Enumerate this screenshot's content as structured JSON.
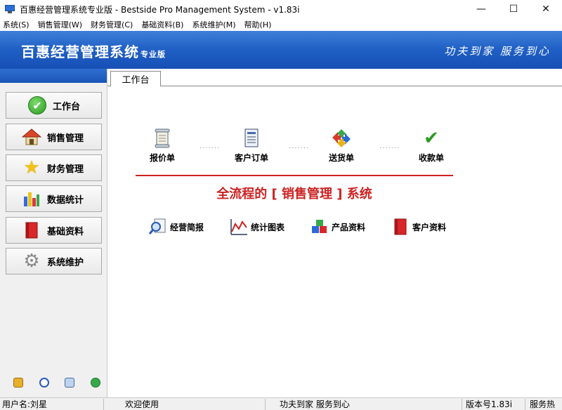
{
  "window": {
    "title": "百惠经营管理系统专业版 - Bestside Pro Management System - v1.83i",
    "minimize": "—",
    "maximize": "☐",
    "close": "✕"
  },
  "menu": [
    "系统(S)",
    "销售管理(W)",
    "财务管理(C)",
    "基础资料(B)",
    "系统维护(M)",
    "帮助(H)"
  ],
  "banner": {
    "title": "百惠经营管理系统",
    "subtitle": "专业版",
    "slogan": "功夫到家 服务到心"
  },
  "sidebar": {
    "items": [
      {
        "label": "工作台",
        "icon": "check-icon"
      },
      {
        "label": "销售管理",
        "icon": "house-icon"
      },
      {
        "label": "财务管理",
        "icon": "star-icon"
      },
      {
        "label": "数据统计",
        "icon": "bar-chart-icon"
      },
      {
        "label": "基础资料",
        "icon": "book-icon"
      },
      {
        "label": "系统维护",
        "icon": "gear-icon"
      }
    ],
    "check_glyph": "✔",
    "star_glyph": "★",
    "gear_glyph": "⚙"
  },
  "tab": {
    "label": "工作台"
  },
  "workflow": {
    "steps": [
      {
        "label": "报价单",
        "icon": "scroll-icon"
      },
      {
        "label": "客户订单",
        "icon": "document-icon"
      },
      {
        "label": "送货单",
        "icon": "recycle-arrows-icon"
      },
      {
        "label": "收款单",
        "icon": "checkmark-icon"
      }
    ],
    "connector": "·······",
    "headline": "全流程的 [ 销售管理 ] 系统",
    "check_glyph": "✔"
  },
  "quick_links": [
    {
      "label": "经营简报",
      "icon": "magnifier-report-icon"
    },
    {
      "label": "统计图表",
      "icon": "line-chart-icon"
    },
    {
      "label": "产品资料",
      "icon": "cubes-icon"
    },
    {
      "label": "客户资料",
      "icon": "red-book-icon"
    }
  ],
  "status": {
    "user": "用户名:刘星",
    "welcome": "欢迎使用",
    "slogan": "功夫到家 服务到心",
    "version": "版本号1.83i",
    "service": "服务热"
  },
  "colors": {
    "banner": "#1f5fc4",
    "accent_red": "#cc2222"
  }
}
